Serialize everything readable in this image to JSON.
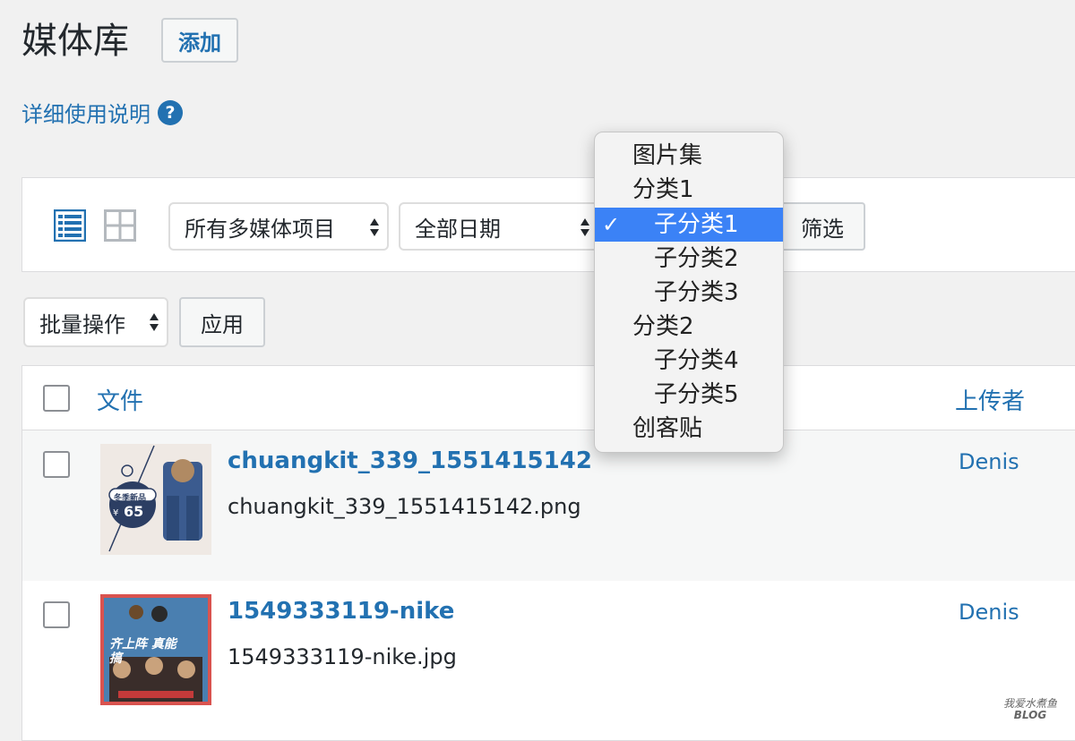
{
  "header": {
    "title": "媒体库",
    "add_label": "添加"
  },
  "help": {
    "label": "详细使用说明",
    "icon_text": "?"
  },
  "filters": {
    "media_type": "所有多媒体项目",
    "date": "全部日期",
    "filter_button": "筛选"
  },
  "bulk": {
    "action": "批量操作",
    "apply": "应用"
  },
  "table": {
    "columns": {
      "file": "文件",
      "author": "上传者"
    },
    "rows": [
      {
        "title": "chuangkit_339_1551415142",
        "filename": "chuangkit_339_1551415142.png",
        "author": "Denis",
        "thumb_badge": "冬季新品",
        "thumb_price": "65",
        "thumb_currency": "¥"
      },
      {
        "title": "1549333119-nike",
        "filename": "1549333119-nike.jpg",
        "author": "Denis",
        "thumb_text": "齐上阵 真能搞"
      }
    ]
  },
  "category_dropdown": {
    "items": [
      "图片集",
      "分类1",
      "子分类1",
      "子分类2",
      "子分类3",
      "分类2",
      "子分类4",
      "子分类5",
      "创客贴"
    ],
    "selected_index": 2,
    "check": "✓"
  },
  "watermark": {
    "line1": "我爱水煮鱼",
    "line2": "BLOG"
  },
  "colors": {
    "link": "#2271b1",
    "selection": "#3b82f6",
    "background": "#f1f1f1"
  }
}
